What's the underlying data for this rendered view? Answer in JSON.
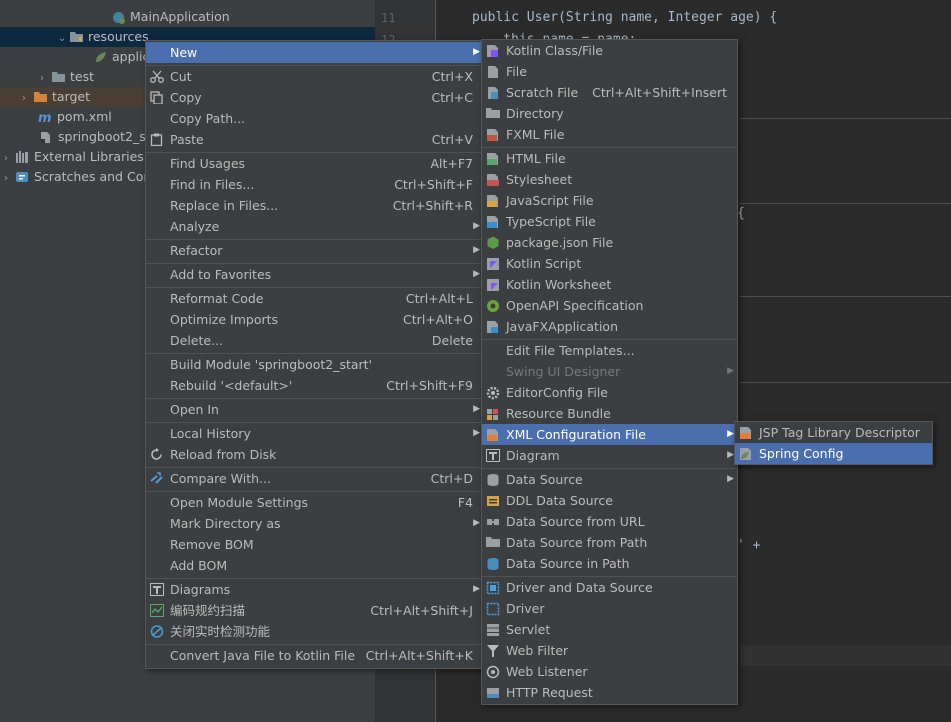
{
  "tree": [
    {
      "label": "MainApplication",
      "icon": "spring-class-icon"
    },
    {
      "label": "resources",
      "icon": "folder-icon"
    },
    {
      "label": "applic",
      "icon": "spring-config-icon"
    },
    {
      "label": "test",
      "icon": "folder-icon"
    },
    {
      "label": "target",
      "icon": "orange-folder-icon"
    },
    {
      "label": "pom.xml",
      "icon": "maven-icon"
    },
    {
      "label": "springboot2_st",
      "icon": "module-file-icon"
    },
    {
      "label": "External Libraries",
      "icon": "library-icon"
    },
    {
      "label": "Scratches and Con",
      "icon": "scratch-icon"
    }
  ],
  "editor": {
    "line_numbers": [
      "11",
      "12"
    ],
    "code_line_11": "public User(String name, Integer age) {",
    "code_line_12": "    this.name = name;",
    "brace": "{",
    "plus_fragment": "' +"
  },
  "context_menu": [
    {
      "label": "New",
      "shortcut": "",
      "submenu": true,
      "selected": true
    },
    {
      "label": "Cut",
      "shortcut": "Ctrl+X",
      "icon": "cut-icon"
    },
    {
      "label": "Copy",
      "shortcut": "Ctrl+C",
      "icon": "copy-icon"
    },
    {
      "label": "Copy Path...",
      "shortcut": ""
    },
    {
      "label": "Paste",
      "shortcut": "Ctrl+V",
      "icon": "paste-icon"
    },
    {
      "label": "Find Usages",
      "shortcut": "Alt+F7"
    },
    {
      "label": "Find in Files...",
      "shortcut": "Ctrl+Shift+F"
    },
    {
      "label": "Replace in Files...",
      "shortcut": "Ctrl+Shift+R"
    },
    {
      "label": "Analyze",
      "shortcut": "",
      "submenu": true
    },
    {
      "label": "Refactor",
      "shortcut": "",
      "submenu": true
    },
    {
      "label": "Add to Favorites",
      "shortcut": "",
      "submenu": true
    },
    {
      "label": "Reformat Code",
      "shortcut": "Ctrl+Alt+L"
    },
    {
      "label": "Optimize Imports",
      "shortcut": "Ctrl+Alt+O"
    },
    {
      "label": "Delete...",
      "shortcut": "Delete"
    },
    {
      "label": "Build Module 'springboot2_start'",
      "shortcut": ""
    },
    {
      "label": "Rebuild '<default>'",
      "shortcut": "Ctrl+Shift+F9"
    },
    {
      "label": "Open In",
      "shortcut": "",
      "submenu": true
    },
    {
      "label": "Local History",
      "shortcut": "",
      "submenu": true
    },
    {
      "label": "Reload from Disk",
      "shortcut": "",
      "icon": "reload-icon"
    },
    {
      "label": "Compare With...",
      "shortcut": "Ctrl+D",
      "icon": "compare-icon"
    },
    {
      "label": "Open Module Settings",
      "shortcut": "F4"
    },
    {
      "label": "Mark Directory as",
      "shortcut": "",
      "submenu": true
    },
    {
      "label": "Remove BOM",
      "shortcut": ""
    },
    {
      "label": "Add BOM",
      "shortcut": ""
    },
    {
      "label": "Diagrams",
      "shortcut": "",
      "submenu": true,
      "icon": "diagram-icon"
    },
    {
      "label": "编码规约扫描",
      "shortcut": "Ctrl+Alt+Shift+J",
      "icon": "scan-icon"
    },
    {
      "label": "关闭实时检测功能",
      "shortcut": "",
      "icon": "disable-icon"
    },
    {
      "label": "Convert Java File to Kotlin File",
      "shortcut": "Ctrl+Alt+Shift+K"
    }
  ],
  "new_menu": [
    {
      "label": "Kotlin Class/File",
      "shortcut": "",
      "icon": "kotlin-file-icon"
    },
    {
      "label": "File",
      "shortcut": "",
      "icon": "file-icon"
    },
    {
      "label": "Scratch File",
      "shortcut": "Ctrl+Alt+Shift+Insert",
      "icon": "scratch-file-icon"
    },
    {
      "label": "Directory",
      "shortcut": "",
      "icon": "folder-icon"
    },
    {
      "label": "FXML File",
      "shortcut": "",
      "icon": "fxml-icon"
    },
    {
      "label": "HTML File",
      "shortcut": "",
      "icon": "html-icon"
    },
    {
      "label": "Stylesheet",
      "shortcut": "",
      "icon": "css-icon"
    },
    {
      "label": "JavaScript File",
      "shortcut": "",
      "icon": "js-icon"
    },
    {
      "label": "TypeScript File",
      "shortcut": "",
      "icon": "ts-icon"
    },
    {
      "label": "package.json File",
      "shortcut": "",
      "icon": "nodejs-icon"
    },
    {
      "label": "Kotlin Script",
      "shortcut": "",
      "icon": "kotlin-script-icon"
    },
    {
      "label": "Kotlin Worksheet",
      "shortcut": "",
      "icon": "kotlin-worksheet-icon"
    },
    {
      "label": "OpenAPI Specification",
      "shortcut": "",
      "icon": "openapi-icon"
    },
    {
      "label": "JavaFXApplication",
      "shortcut": "",
      "icon": "javafx-icon"
    },
    {
      "label": "Edit File Templates...",
      "shortcut": ""
    },
    {
      "label": "Swing UI Designer",
      "shortcut": "",
      "submenu": true,
      "disabled": true
    },
    {
      "label": "EditorConfig File",
      "shortcut": "",
      "icon": "gear-icon"
    },
    {
      "label": "Resource Bundle",
      "shortcut": "",
      "icon": "resource-bundle-icon"
    },
    {
      "label": "XML Configuration File",
      "shortcut": "",
      "submenu": true,
      "selected": true,
      "icon": "xml-icon"
    },
    {
      "label": "Diagram",
      "shortcut": "",
      "submenu": true,
      "icon": "diagram-icon"
    },
    {
      "label": "Data Source",
      "shortcut": "",
      "submenu": true,
      "icon": "database-icon"
    },
    {
      "label": "DDL Data Source",
      "shortcut": "",
      "icon": "ddl-icon"
    },
    {
      "label": "Data Source from URL",
      "shortcut": "",
      "icon": "url-icon"
    },
    {
      "label": "Data Source from Path",
      "shortcut": "",
      "icon": "folder-icon"
    },
    {
      "label": "Data Source in Path",
      "shortcut": "",
      "icon": "database-icon"
    },
    {
      "label": "Driver and Data Source",
      "shortcut": "",
      "icon": "driver-icon"
    },
    {
      "label": "Driver",
      "shortcut": "",
      "icon": "driver-icon"
    },
    {
      "label": "Servlet",
      "shortcut": "",
      "icon": "servlet-icon"
    },
    {
      "label": "Web Filter",
      "shortcut": "",
      "icon": "filter-icon"
    },
    {
      "label": "Web Listener",
      "shortcut": "",
      "icon": "listener-icon"
    },
    {
      "label": "HTTP Request",
      "shortcut": "",
      "icon": "api-icon"
    }
  ],
  "xml_menu": [
    {
      "label": "JSP Tag Library Descriptor",
      "icon": "xml-icon"
    },
    {
      "label": "Spring Config",
      "icon": "spring-config-icon",
      "selected": true
    }
  ]
}
